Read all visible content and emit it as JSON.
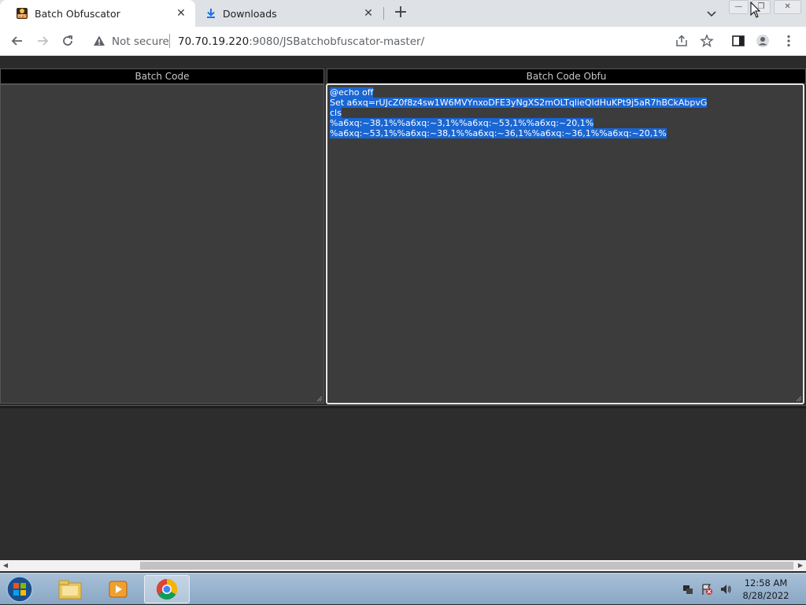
{
  "browser": {
    "tabs": [
      {
        "title": "Batch Obfuscator",
        "icon": "hfs-icon",
        "active": true
      },
      {
        "title": "Downloads",
        "icon": "download-icon",
        "active": false
      }
    ],
    "address": {
      "security_label": "Not secure",
      "host": "70.70.19.220",
      "path": ":9080/JSBatchobfuscator-master/"
    }
  },
  "page": {
    "left_panel": {
      "header": "Batch Code",
      "content": ""
    },
    "right_panel": {
      "header": "Batch Code Obfu",
      "lines": [
        "@echo off",
        "Set a6xq=rUJcZ0f8z4sw1W6MVYnxoDFE3yNgXS2mOLTqlieQIdHuKPt9j5aR7hBCkAbpvG",
        "cls",
        "%a6xq:~38,1%%a6xq:~3,1%%a6xq:~53,1%%a6xq:~20,1%",
        "%a6xq:~53,1%%a6xq:~38,1%%a6xq:~36,1%%a6xq:~36,1%%a6xq:~20,1%"
      ],
      "selected": true
    }
  },
  "taskbar": {
    "apps": [
      "file-explorer-icon",
      "media-player-icon",
      "chrome-icon"
    ],
    "clock": {
      "time": "12:58 AM",
      "date": "8/28/2022"
    }
  },
  "colors": {
    "selection": "#1a66d2",
    "panel_bg": "#3c3c3c",
    "page_bg": "#2b2b2b"
  }
}
